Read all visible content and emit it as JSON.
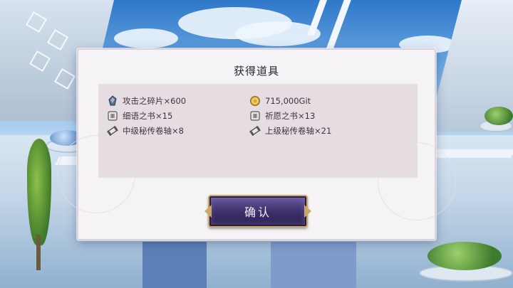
{
  "dialog": {
    "title": "获得道具",
    "items": [
      {
        "label": "攻击之碎片×600",
        "icon": "shard-icon"
      },
      {
        "label": "715,000Git",
        "icon": "gold-coin-icon"
      },
      {
        "label": "细语之书×15",
        "icon": "book-icon"
      },
      {
        "label": "祈愿之书×13",
        "icon": "book-icon"
      },
      {
        "label": "中级秘传卷轴×8",
        "icon": "scroll-icon"
      },
      {
        "label": "上级秘传卷轴×21",
        "icon": "scroll-icon"
      }
    ],
    "confirm_label": "确认"
  },
  "colors": {
    "panel": "#e5dde2",
    "button": "#3b2f6a",
    "button_border": "#c8a96a",
    "coin": "#d8a93a"
  }
}
